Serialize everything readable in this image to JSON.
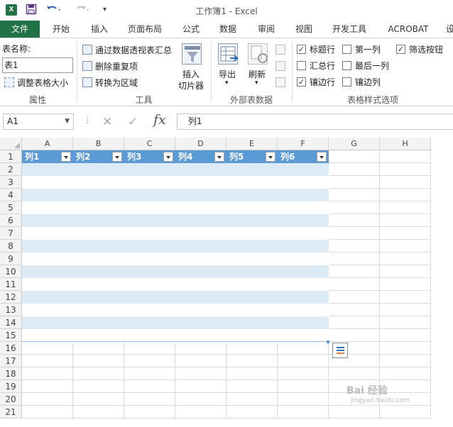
{
  "window": {
    "title": "工作簿1 - Excel",
    "app_icon": "X"
  },
  "quick_access": {
    "save_icon": "save-icon",
    "undo_icon": "undo-icon",
    "redo_icon": "redo-icon",
    "customize_icon": "customize-icon"
  },
  "tabs": [
    {
      "label": "文件",
      "active": true
    },
    {
      "label": "开始"
    },
    {
      "label": "插入"
    },
    {
      "label": "页面布局"
    },
    {
      "label": "公式"
    },
    {
      "label": "数据"
    },
    {
      "label": "审阅"
    },
    {
      "label": "视图"
    },
    {
      "label": "开发工具"
    },
    {
      "label": "ACROBAT"
    },
    {
      "label": "设"
    }
  ],
  "ribbon": {
    "properties": {
      "table_name_label": "表名称:",
      "table_name_value": "表1",
      "resize_table": "调整表格大小",
      "group_label": "属性"
    },
    "tools": {
      "pivot": "通过数据透视表汇总",
      "remove_duplicates": "删除重复项",
      "convert_range": "转换为区域",
      "insert_slicer": [
        "插入",
        "切片器"
      ],
      "group_label": "工具"
    },
    "external": {
      "export": "导出",
      "refresh": "刷新",
      "group_label": "外部表数据"
    },
    "style_options": {
      "header_row": "标题行",
      "total_row": "汇总行",
      "banded_rows": "镶边行",
      "first_column": "第一列",
      "last_column": "最后一列",
      "banded_columns": "镶边列",
      "filter_button": "筛选按钮",
      "group_label": "表格样式选项",
      "checked": {
        "header_row": true,
        "total_row": false,
        "banded_rows": true,
        "first_column": false,
        "last_column": false,
        "banded_columns": false,
        "filter_button": true
      }
    }
  },
  "formula_bar": {
    "name_box": "A1",
    "cancel": "✕",
    "enter": "✓",
    "fx": "fx",
    "content": "列1"
  },
  "sheet": {
    "columns": [
      "A",
      "B",
      "C",
      "D",
      "E",
      "F",
      "G",
      "H"
    ],
    "rows": [
      "1",
      "2",
      "3",
      "4",
      "5",
      "6",
      "7",
      "8",
      "9",
      "10",
      "11",
      "12",
      "13",
      "14",
      "15",
      "16",
      "17",
      "18",
      "19",
      "20",
      "21"
    ],
    "table_headers": [
      "列1",
      "列2",
      "列3",
      "列4",
      "列5",
      "列6"
    ]
  },
  "watermark": {
    "text": "Bai 经验",
    "sub": "jingyan.baidu.com"
  },
  "colors": {
    "brand": "#217346",
    "table_header": "#5b9bd5",
    "band": "#ddebf7"
  }
}
